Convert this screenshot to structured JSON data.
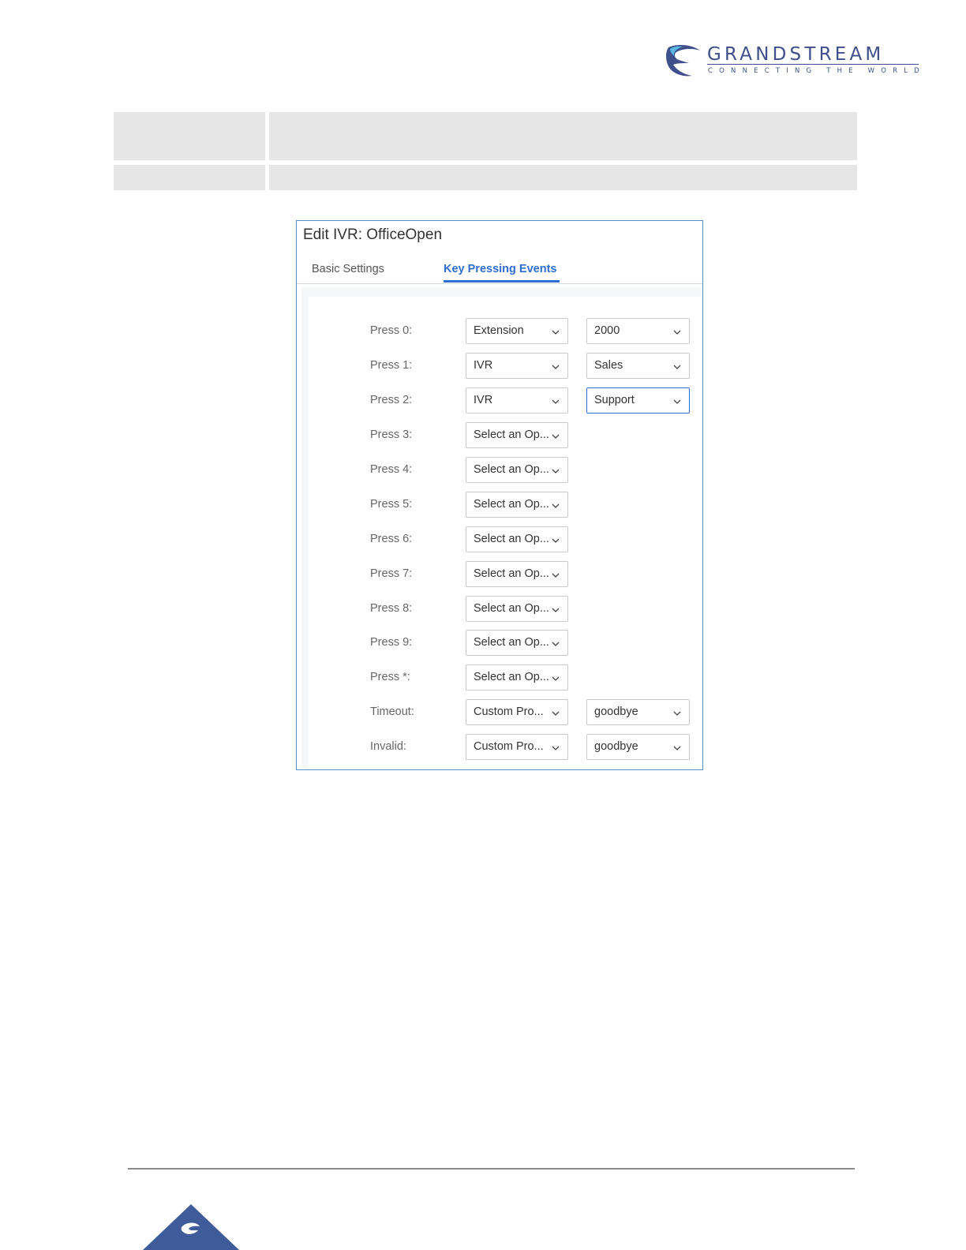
{
  "brand": {
    "name": "GRANDSTREAM",
    "tagline": "CONNECTING THE WORLD",
    "color": "#3f4f8c"
  },
  "dialog": {
    "title": "Edit IVR: OfficeOpen",
    "tabs": [
      {
        "label": "Basic Settings",
        "active": false
      },
      {
        "label": "Key Pressing Events",
        "active": true
      }
    ],
    "accent": "#2f6dd1",
    "rows": [
      {
        "label": "Press 0:",
        "option": "Extension",
        "target": "2000"
      },
      {
        "label": "Press 1:",
        "option": "IVR",
        "target": "Sales"
      },
      {
        "label": "Press 2:",
        "option": "IVR",
        "target": "Support"
      },
      {
        "label": "Press 3:",
        "option": "Select an Op...",
        "target": null
      },
      {
        "label": "Press 4:",
        "option": "Select an Op...",
        "target": null
      },
      {
        "label": "Press 5:",
        "option": "Select an Op...",
        "target": null
      },
      {
        "label": "Press 6:",
        "option": "Select an Op...",
        "target": null
      },
      {
        "label": "Press 7:",
        "option": "Select an Op...",
        "target": null
      },
      {
        "label": "Press 8:",
        "option": "Select an Op...",
        "target": null
      },
      {
        "label": "Press 9:",
        "option": "Select an Op...",
        "target": null
      },
      {
        "label": "Press *:",
        "option": "Select an Op...",
        "target": null
      },
      {
        "label": "Timeout:",
        "option": "Custom Pro...",
        "target": "goodbye"
      },
      {
        "label": "Invalid:",
        "option": "Custom Pro...",
        "target": "goodbye"
      }
    ]
  },
  "icons": {
    "logo": "grandstream-logo-icon",
    "dropdown": "chevron-down-icon",
    "footer": "grandstream-footer-icon"
  }
}
